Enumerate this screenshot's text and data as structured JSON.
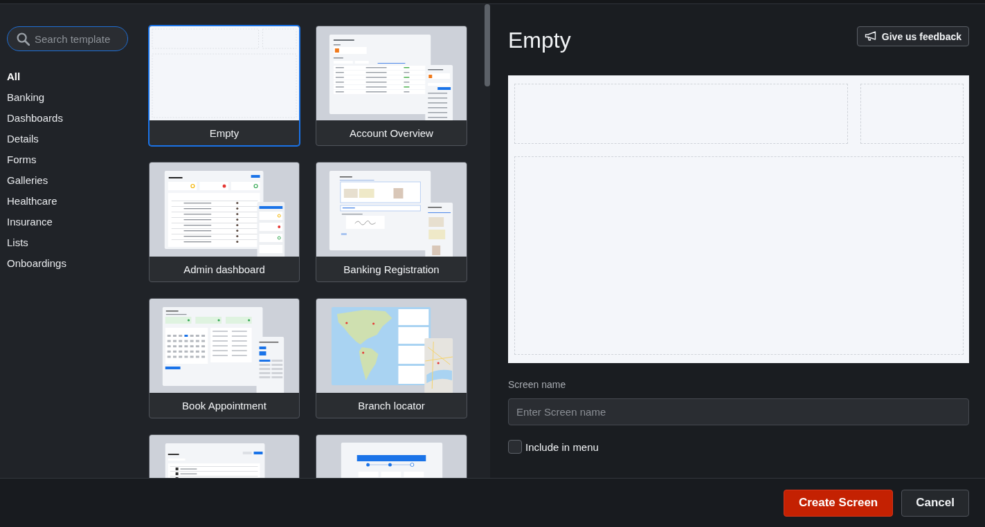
{
  "sidebar": {
    "search": {
      "placeholder": "Search template"
    },
    "categories": [
      {
        "label": "All",
        "selected": true
      },
      {
        "label": "Banking",
        "selected": false
      },
      {
        "label": "Dashboards",
        "selected": false
      },
      {
        "label": "Details",
        "selected": false
      },
      {
        "label": "Forms",
        "selected": false
      },
      {
        "label": "Galleries",
        "selected": false
      },
      {
        "label": "Healthcare",
        "selected": false
      },
      {
        "label": "Insurance",
        "selected": false
      },
      {
        "label": "Lists",
        "selected": false
      },
      {
        "label": "Onboardings",
        "selected": false
      }
    ]
  },
  "templates": [
    {
      "label": "Empty",
      "selected": true,
      "kind": "empty"
    },
    {
      "label": "Account Overview",
      "selected": false,
      "kind": "table"
    },
    {
      "label": "Admin dashboard",
      "selected": false,
      "kind": "dashboard"
    },
    {
      "label": "Banking Registration",
      "selected": false,
      "kind": "registration"
    },
    {
      "label": "Book Appointment",
      "selected": false,
      "kind": "calendar"
    },
    {
      "label": "Branch locator",
      "selected": false,
      "kind": "map"
    },
    {
      "selected": false,
      "kind": "products"
    },
    {
      "selected": false,
      "kind": "calculator"
    }
  ],
  "preview": {
    "title": "Empty",
    "feedback_button": "Give us feedback"
  },
  "form": {
    "screen_name": {
      "label": "Screen name",
      "placeholder": "Enter Screen name"
    },
    "include_in_menu": {
      "label": "Include in menu",
      "checked": false
    }
  },
  "footer": {
    "buttons": [
      {
        "label": "Create Screen",
        "kind": "primary"
      },
      {
        "label": "Cancel",
        "kind": "secondary"
      }
    ]
  }
}
